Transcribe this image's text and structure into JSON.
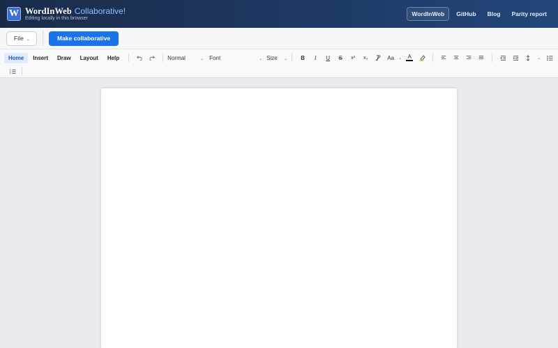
{
  "header": {
    "brand_name": "WordInWeb",
    "brand_tag": "Collaborative!",
    "subtitle": "Editing locally in this browser",
    "logo_letter": "W",
    "nav": [
      {
        "label": "WordInWeb",
        "active": true
      },
      {
        "label": "GitHub"
      },
      {
        "label": "Blog"
      },
      {
        "label": "Parity report"
      }
    ]
  },
  "actionbar": {
    "file_label": "File",
    "collab_label": "Make collaborative"
  },
  "ribbon": {
    "tabs": [
      "Home",
      "Insert",
      "Draw",
      "Layout",
      "Help"
    ],
    "undo_icon": "undo-icon",
    "redo_icon": "redo-icon",
    "style_value": "Normal",
    "font_value": "Font",
    "size_value": "Size",
    "bold": "B",
    "italic": "I",
    "underline": "U",
    "strike": "S",
    "superscript": "x²",
    "subscript": "x₂",
    "case_label": "Aa",
    "font_color_label": "A",
    "highlight_color": "#f5d90a",
    "font_color": "#111111"
  },
  "colors": {
    "accent": "#1a73e8",
    "header_bg": "#1a2b4a"
  }
}
